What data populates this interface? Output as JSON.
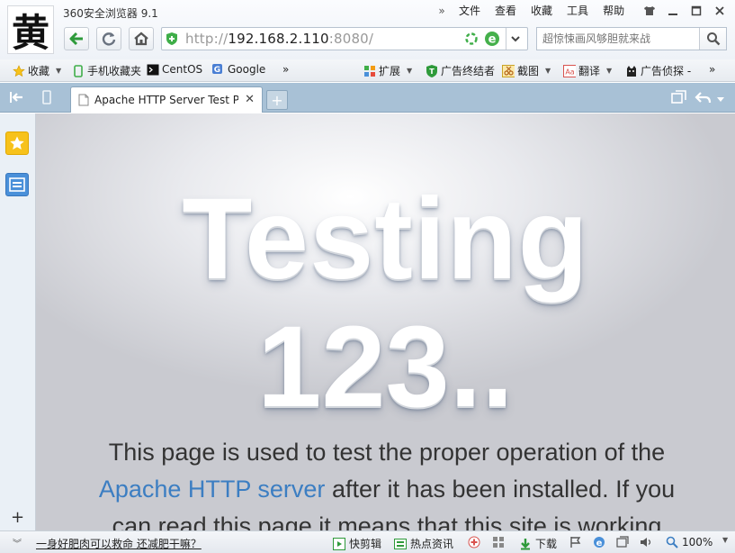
{
  "window": {
    "logo_char": "黄",
    "app_title": "360安全浏览器 9.1",
    "menu": [
      "文件",
      "查看",
      "收藏",
      "工具",
      "帮助"
    ]
  },
  "nav": {
    "url_scheme": "http://",
    "url_host": "192.168.2.110",
    "url_port_path": ":8080/",
    "search_placeholder": "超惊悚画风够胆就来战"
  },
  "bookmarks_left": [
    {
      "label": "收藏",
      "icon": "star-icon"
    },
    {
      "label": "手机收藏夹",
      "icon": "phone-icon"
    },
    {
      "label": "CentOS",
      "icon": "terminal-icon"
    },
    {
      "label": "Google",
      "icon": "google-icon"
    }
  ],
  "bookmarks_right": [
    {
      "label": "扩展",
      "icon": "puzzle-icon"
    },
    {
      "label": "广告终结者",
      "icon": "shield-icon"
    },
    {
      "label": "截图",
      "icon": "scissors-icon"
    },
    {
      "label": "翻译",
      "icon": "translate-icon"
    },
    {
      "label": "广告侦探 -",
      "icon": "cat-icon"
    }
  ],
  "tab": {
    "title": "Apache HTTP Server Test P"
  },
  "page": {
    "headline_1": "Testing",
    "headline_2": "123..",
    "para_1": "This page is used to test the proper operation of the",
    "para_link": "Apache HTTP server",
    "para_2": " after it has been installed. If you",
    "para_3": "can read this page it means that this site is working"
  },
  "status": {
    "news": "一身好肥肉可以救命 还减肥干嘛？",
    "items": [
      "快剪辑",
      "热点资讯",
      "下载"
    ],
    "zoom": "100%"
  },
  "colors": {
    "tabbar": "#a8c1d6",
    "link": "#3c7ec2",
    "nav_green": "#2e9a3a",
    "star_yellow": "#f7c21b",
    "sidebar_blue": "#4a90d9"
  }
}
